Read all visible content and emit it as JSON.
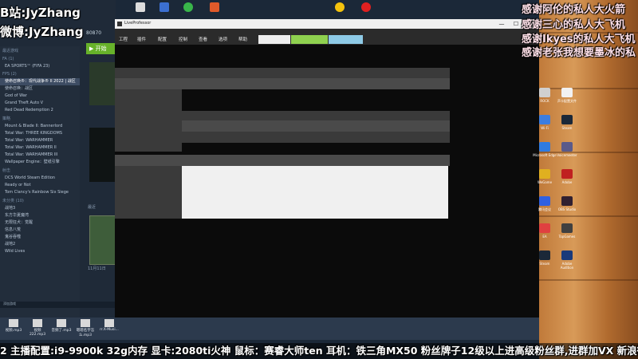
{
  "overlay": {
    "bilibili": "B站:JyZhang",
    "weibo": "微博:JyZhang",
    "thanks": [
      "感谢阿伦的私人大火箭",
      "感谢三心的私人大飞机",
      "感谢Ikyes的私人大飞机",
      "感谢老张我想要墨冰的私"
    ],
    "ticker": "2 主播配置:i9-9900k 32g内存 显卡:2080ti火神 鼠标：赛睿大师ten 耳机：铁三角MX50 粉丝牌子12级以上进高级粉丝群,进群加VX 新浪微"
  },
  "steam": {
    "account_number": "80870",
    "play_label": "▶ 开始",
    "recent_label": "最近",
    "date_label": "11月11日",
    "bottom_label": "添加游戏",
    "sections": [
      {
        "label": "最近游戏",
        "items": []
      },
      {
        "label": "FA (1)",
        "items": [
          "EA SPORTS™ (FIFA 23)"
        ]
      },
      {
        "label": "FPS (2)",
        "items": [
          "使命召唤®：现代战争® II 2022 | 战区",
          "使命召唤：战区"
        ]
      },
      {
        "label": "",
        "items": [
          "God of War",
          "Grand Theft Auto V",
          "Red Dead Redemption 2"
        ]
      },
      {
        "label": "策略",
        "items": [
          "Mount & Blade II: Bannerlord",
          "Total War: THREE KINGDOMS",
          "Total War: WARHAMMER",
          "Total War: WARHAMMER II",
          "Total War: WARHAMMER III",
          "Wallpaper Engine：壁纸引擎"
        ]
      },
      {
        "label": "射击",
        "items": [
          "DCS World Steam Edition",
          "Ready or Not",
          "Tom Clancy's Rainbow Six Siege"
        ]
      },
      {
        "label": "未分类 (10)",
        "items": [
          "战地3",
          "东方华夏魔湾",
          "无限狂犬：觉醒",
          "信息八荒",
          "鬼谷吞噬",
          "战地2",
          "Wild Lives"
        ]
      }
    ]
  },
  "liveprofessor": {
    "title": "LiveProfessor",
    "menu": [
      "工程",
      "插件",
      "配置",
      "控制",
      "查看",
      "选项",
      "帮助"
    ],
    "minimize": "—",
    "maximize": "☐",
    "close": "✕"
  },
  "files": [
    "视频.mp3",
    "视频222.mp3",
    "音频了.mp3",
    "嗯嗯名字怎么.mp3",
    "rr.X-Musi..."
  ],
  "desktop_icons": [
    "ROCK",
    "声卡配置文件",
    "Wi-Fi",
    "Steam",
    "Microsoft Edge",
    "Voicemeeter",
    "WeGame",
    "Adobe",
    "腾讯会议",
    "OBS Studio",
    "EA",
    "TopGames",
    "Steam",
    "Adobe Audition"
  ],
  "colors": {
    "play": "#67b22a",
    "accent_green": "#8fd14f",
    "accent_blue": "#8ecae6"
  }
}
